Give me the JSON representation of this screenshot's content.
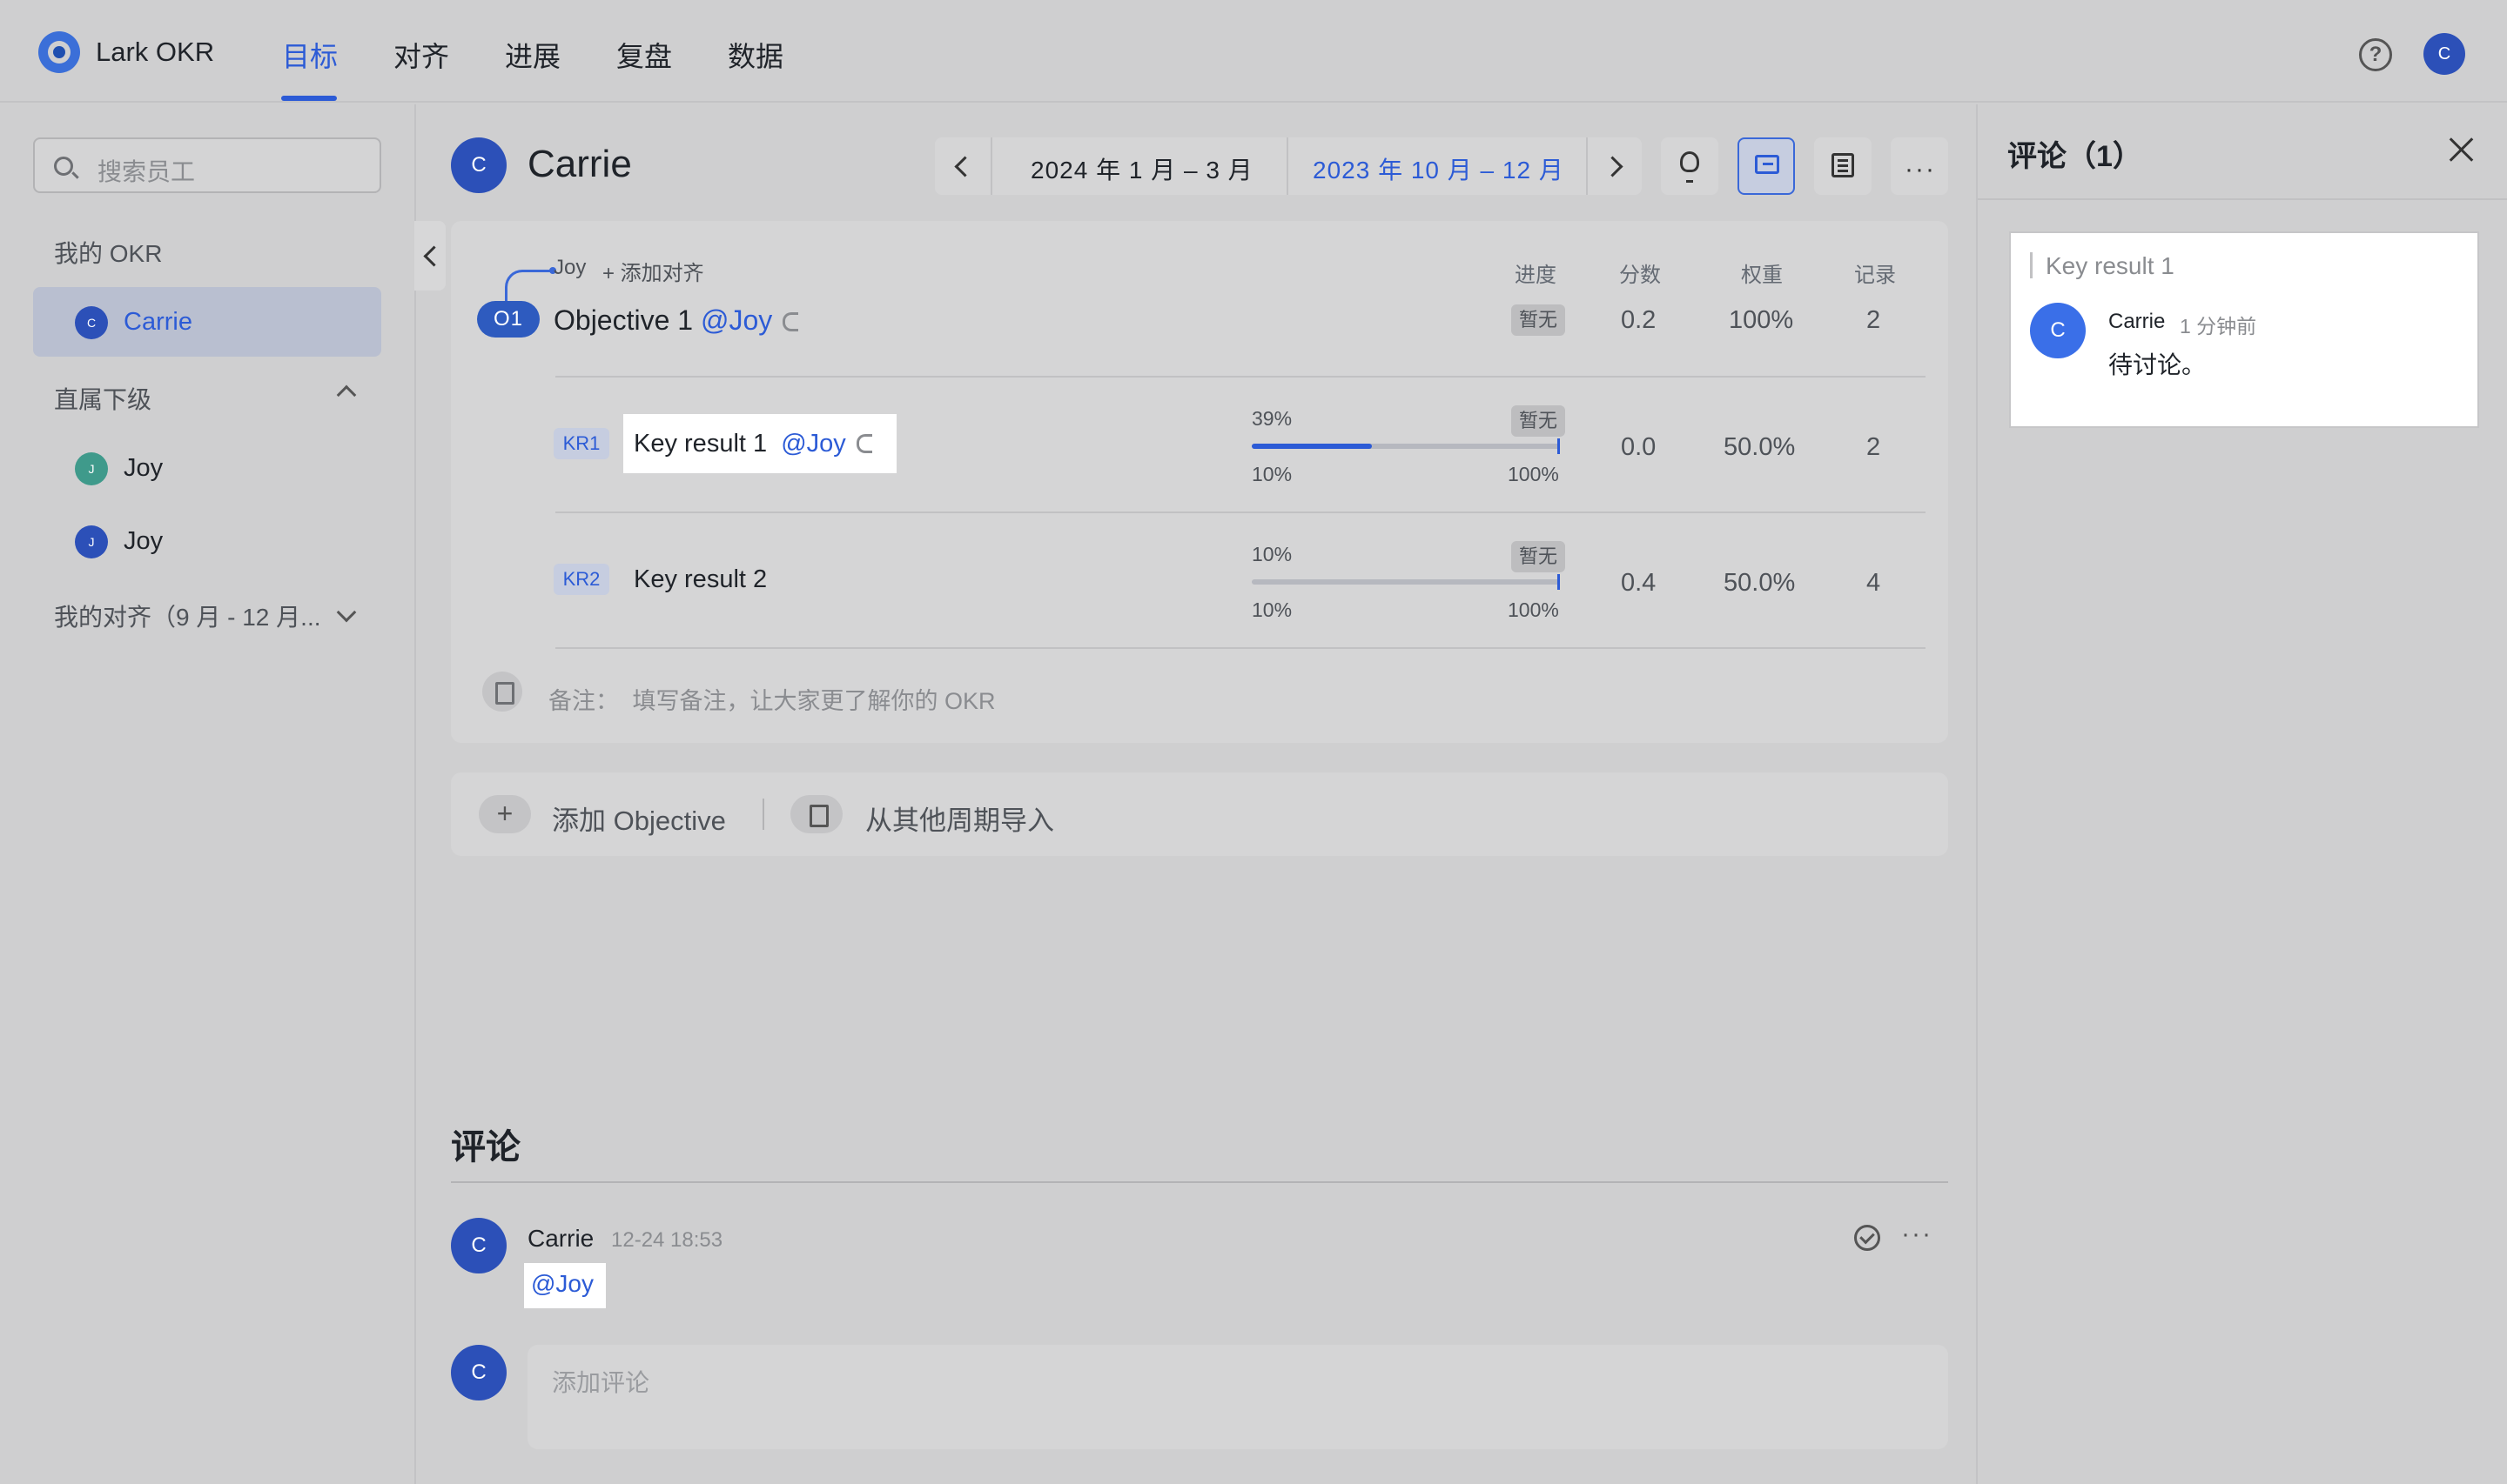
{
  "app": {
    "name": "Lark OKR"
  },
  "nav": {
    "tabs": [
      {
        "label": "目标",
        "active": true
      },
      {
        "label": "对齐"
      },
      {
        "label": "进展"
      },
      {
        "label": "复盘"
      },
      {
        "label": "数据"
      }
    ],
    "user_initial": "C"
  },
  "sidebar": {
    "search_placeholder": "搜索员工",
    "my_okr_label": "我的 OKR",
    "my_okr_user": {
      "name": "Carrie",
      "initial": "C"
    },
    "reports_label": "直属下级",
    "reports": [
      {
        "name": "Joy",
        "initial": "J",
        "color": "#3f9a8b"
      },
      {
        "name": "Joy",
        "initial": "J",
        "color": "#2c50b8"
      }
    ],
    "my_alignment_label": "我的对齐（9 月 - 12 月..."
  },
  "header": {
    "avatar_initial": "C",
    "name": "Carrie",
    "period_current": "2024 年 1 月 – 3 月",
    "period_selected": "2023 年 10 月 – 12 月"
  },
  "okr": {
    "aligned_to": "Joy",
    "add_alignment": "+ 添加对齐",
    "columns": {
      "progress": "进度",
      "score": "分数",
      "weight": "权重",
      "records": "记录"
    },
    "objective": {
      "badge": "O1",
      "title": "Objective 1",
      "mention": "@Joy",
      "progress": "暂无",
      "score": "0.2",
      "weight": "100%",
      "records": "2"
    },
    "key_results": [
      {
        "badge": "KR1",
        "title": "Key result 1",
        "mention": "@Joy",
        "progress_pct_label": "39%",
        "progress_value": 0.39,
        "status": "暂无",
        "min_label": "10%",
        "max_label": "100%",
        "score": "0.0",
        "weight": "50.0%",
        "records": "2"
      },
      {
        "badge": "KR2",
        "title": "Key result 2",
        "mention": "",
        "progress_pct_label": "10%",
        "progress_value": 0.1,
        "status": "暂无",
        "min_label": "10%",
        "max_label": "100%",
        "score": "0.4",
        "weight": "50.0%",
        "records": "4"
      }
    ],
    "note_label": "备注：",
    "note_placeholder": "填写备注，让大家更了解你的 OKR"
  },
  "actions": {
    "add_objective": "添加 Objective",
    "import_from_period": "从其他周期导入"
  },
  "comments": {
    "title": "评论",
    "items": [
      {
        "initial": "C",
        "author": "Carrie",
        "time": "12-24 18:53",
        "body": "@Joy"
      }
    ],
    "input_placeholder": "添加评论",
    "input_avatar_initial": "C"
  },
  "right_panel": {
    "title": "评论（1）",
    "quote": "Key result 1",
    "comment": {
      "initial": "C",
      "author": "Carrie",
      "time": "1 分钟前",
      "text": "待讨论。"
    }
  }
}
